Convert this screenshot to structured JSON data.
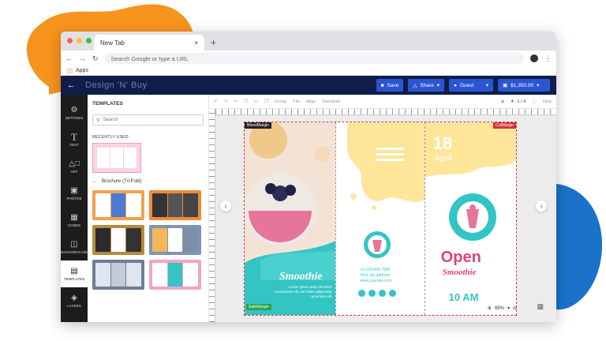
{
  "browser": {
    "tab_title": "New Tab",
    "tab_close": "×",
    "new_tab": "+",
    "address_placeholder": "Search Google or type a URL",
    "bookmarks_label": "Apps"
  },
  "app": {
    "logo": "Design 'N' Buy",
    "header_buttons": [
      "Save",
      "Share",
      "Guest",
      "$1,350.00"
    ]
  },
  "rail": {
    "items": [
      {
        "label": "SETTINGS",
        "icon": "gear-icon"
      },
      {
        "label": "TEXT",
        "icon": "text-icon"
      },
      {
        "label": "ART",
        "icon": "shapes-icon"
      },
      {
        "label": "PHOTOS",
        "icon": "photo-icon"
      },
      {
        "label": "CODES",
        "icon": "qr-icon"
      },
      {
        "label": "BACKGROU ND",
        "icon": "background-icon"
      },
      {
        "label": "TEMPLATES",
        "icon": "templates-icon"
      },
      {
        "label": "LAYERS",
        "icon": "layers-icon"
      }
    ]
  },
  "panel": {
    "title": "TEMPLATES",
    "search_placeholder": "Search",
    "recently_used": "RECENTLY USED",
    "category": "Brochure (Tri-Fold)"
  },
  "canvas_toolbar": {
    "group": "Group",
    "file": "File",
    "align": "Align",
    "distribute": "Distribute",
    "pages": "4 - 1 / 4",
    "help": "Help",
    "zoom": "69%"
  },
  "document": {
    "safe_margin_top": "BleedMargin",
    "safe_margin_right": "CutMargin",
    "safe_margin_bottom": "SafeMargin",
    "smoothie_title": "Smoothie",
    "smoothie_body": "Lorem ipsum dolor sit amet consectetur elit, sed diam adipiscing nonummy elit",
    "contact_phone": "+0 123-456-7890",
    "contact_address": "Your city address",
    "contact_web": "www.yoursite.com",
    "date_day": "18",
    "date_month": "April",
    "open_text": "Open",
    "open_sub": "Smoothie",
    "time": "10 AM",
    "logo_ring_text": "YOUR LOGO YOUR LOGO"
  },
  "colors": {
    "app_header": "#101d4a",
    "accent_blue": "#2b56d1",
    "orange_blob": "#f7941d",
    "blue_blob": "#1a73c8",
    "teal": "#33c4c4",
    "pink": "#e0457b",
    "yellow": "#fde59a"
  }
}
